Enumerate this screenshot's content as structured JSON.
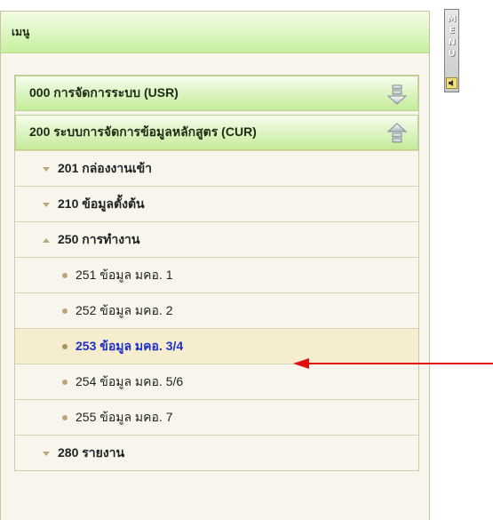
{
  "panel": {
    "title": "เมนู"
  },
  "sections": [
    {
      "label": "000 การจัดการระบบ (USR)",
      "icon": "arrow-down-icon",
      "expanded": false
    },
    {
      "label": "200 ระบบการจัดการข้อมูลหลักสูตร (CUR)",
      "icon": "arrow-up-icon",
      "expanded": true,
      "items": [
        {
          "label": "201 กล่องงานเข้า",
          "icon": "triangle-down-icon",
          "level": 2
        },
        {
          "label": "210 ข้อมูลตั้งต้น",
          "icon": "triangle-down-icon",
          "level": 2
        },
        {
          "label": "250 การทำงาน",
          "icon": "triangle-up-icon",
          "level": 2
        },
        {
          "label": "251 ข้อมูล มคอ. 1",
          "icon": "bullet-icon",
          "level": 3
        },
        {
          "label": "252 ข้อมูล มคอ. 2",
          "icon": "bullet-icon",
          "level": 3
        },
        {
          "label": "253 ข้อมูล มคอ. 3/4",
          "icon": "bullet-icon",
          "level": 3,
          "active": true
        },
        {
          "label": "254 ข้อมูล มคอ. 5/6",
          "icon": "bullet-icon",
          "level": 3
        },
        {
          "label": "255 ข้อมูล มคอ. 7",
          "icon": "bullet-icon",
          "level": 3
        },
        {
          "label": "280 รายงาน",
          "icon": "triangle-down-icon",
          "level": 2
        }
      ]
    }
  ],
  "side_tab": {
    "letters": [
      "M",
      "E",
      "N",
      "U"
    ],
    "icon": "speaker-icon"
  },
  "colors": {
    "header_gradient": "#c8ef9f",
    "panel_bg": "#f8f6ec",
    "active_text": "#1b2fc9",
    "active_bg": "#f6edcf",
    "arrow": "#e01010"
  }
}
